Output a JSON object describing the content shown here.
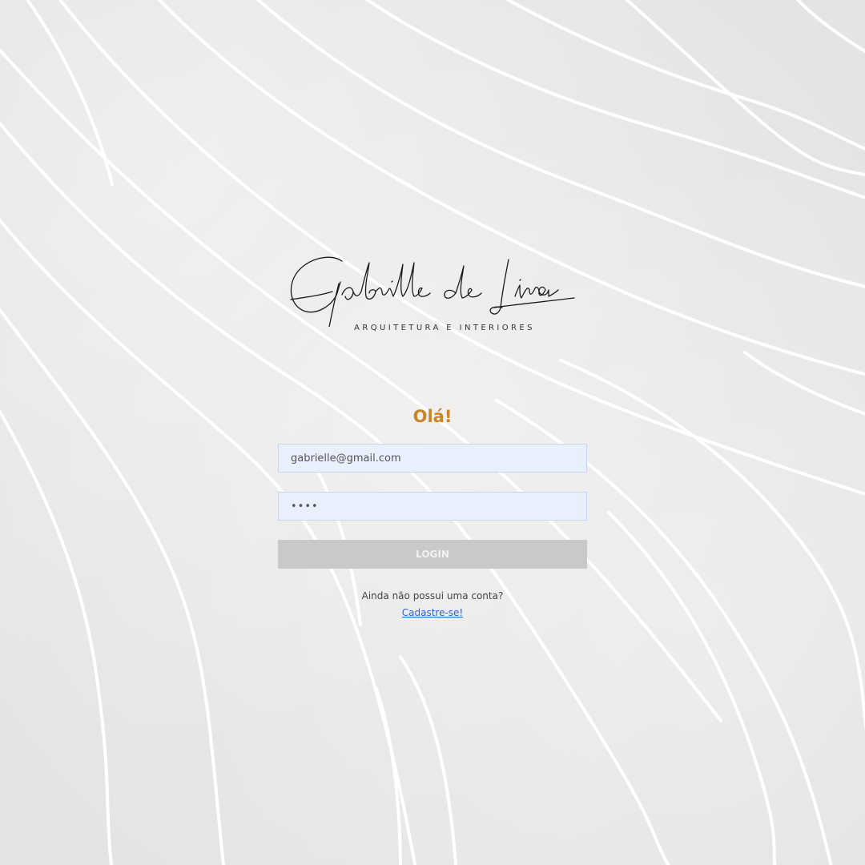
{
  "brand": {
    "name": "Gabrielle de Lima",
    "tagline": "ARQUITETURA E INTERIORES"
  },
  "login": {
    "greeting": "Olá!",
    "email_value": "gabrielle@gmail.com",
    "password_value": "1234",
    "login_label": "LOGIN",
    "signup_prompt": "Ainda não possui uma conta?",
    "signup_link": "Cadastre-se!"
  },
  "colors": {
    "background": "#e9e9e9",
    "greeting": "#c8862a",
    "input_background": "#e8f0fe",
    "button_background": "#c9c9c9",
    "link": "#2a63d8"
  }
}
